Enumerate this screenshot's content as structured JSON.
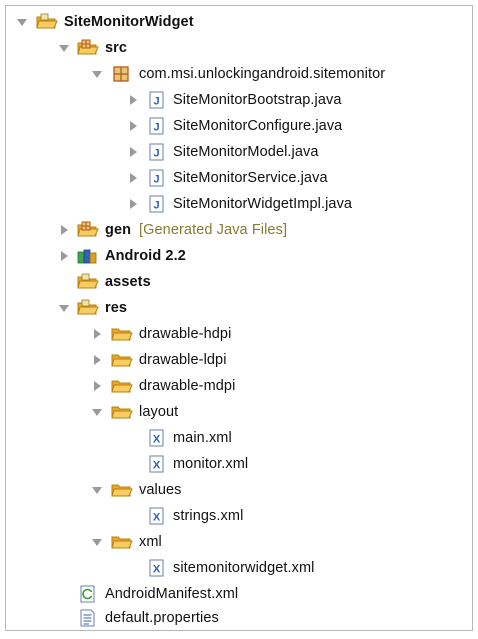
{
  "tree": {
    "project": "SiteMonitorWidget",
    "src": "src",
    "package": "com.msi.unlockingandroid.sitemonitor",
    "java_files": [
      "SiteMonitorBootstrap.java",
      "SiteMonitorConfigure.java",
      "SiteMonitorModel.java",
      "SiteMonitorService.java",
      "SiteMonitorWidgetImpl.java"
    ],
    "gen": "gen",
    "gen_decoration": "[Generated Java Files]",
    "android_lib": "Android 2.2",
    "assets": "assets",
    "res": "res",
    "drawable_hdpi": "drawable-hdpi",
    "drawable_ldpi": "drawable-ldpi",
    "drawable_mdpi": "drawable-mdpi",
    "layout": "layout",
    "layout_files": [
      "main.xml",
      "monitor.xml"
    ],
    "values": "values",
    "values_files": [
      "strings.xml"
    ],
    "xml": "xml",
    "xml_files": [
      "sitemonitorwidget.xml"
    ],
    "manifest": "AndroidManifest.xml",
    "default_props": "default.properties"
  },
  "colors": {
    "folder": "#f3b53a",
    "folder_dark": "#c98a10",
    "java_blue": "#2f62b8",
    "twisty": "#9a9a9a",
    "decoration": "#8a7a2e"
  },
  "icons": {
    "project": "project-folder-icon",
    "src": "source-folder-icon",
    "package": "package-icon",
    "java": "java-file-icon",
    "gen": "generated-source-folder-icon",
    "library": "library-icon",
    "folder": "folder-icon",
    "xml": "xml-file-icon",
    "manifest": "manifest-file-icon",
    "properties": "properties-file-icon"
  }
}
